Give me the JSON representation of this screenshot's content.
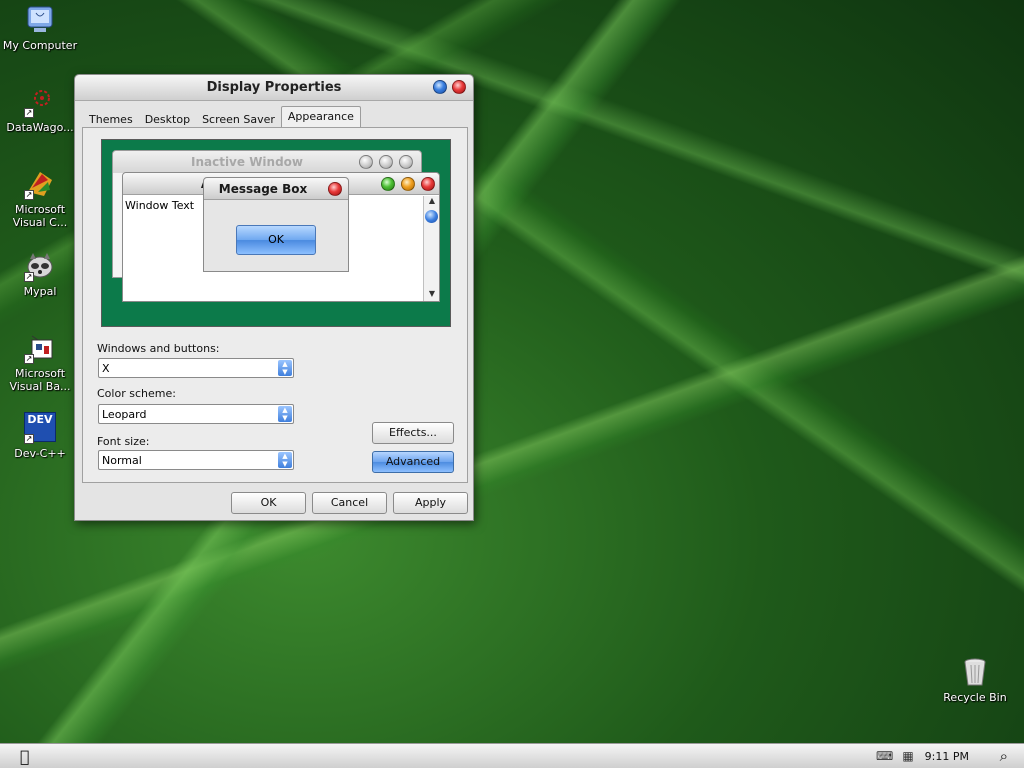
{
  "desktop": {
    "icons": [
      {
        "label": "My Computer"
      },
      {
        "label": "DataWago..."
      },
      {
        "label": "Microsoft Visual C..."
      },
      {
        "label": "Mypal"
      },
      {
        "label": "Microsoft Visual Ba..."
      },
      {
        "label": "Dev-C++",
        "badge": "DEV"
      },
      {
        "label": "Recycle Bin"
      }
    ]
  },
  "dialog": {
    "title": "Display Properties",
    "tabs": [
      "Themes",
      "Desktop",
      "Screen Saver",
      "Appearance"
    ],
    "active_tab": "Appearance",
    "preview": {
      "inactive_title": "Inactive Window",
      "active_title": "Active Window",
      "window_text": "Window Text",
      "message_title": "Message Box",
      "ok_label": "OK"
    },
    "fields": {
      "windows_buttons_label": "Windows and buttons:",
      "windows_buttons_value": "X",
      "color_scheme_label": "Color scheme:",
      "color_scheme_value": "Leopard",
      "font_size_label": "Font size:",
      "font_size_value": "Normal"
    },
    "buttons": {
      "effects": "Effects...",
      "advanced": "Advanced",
      "ok": "OK",
      "cancel": "Cancel",
      "apply": "Apply"
    }
  },
  "taskbar": {
    "time": "9:11 PM"
  }
}
